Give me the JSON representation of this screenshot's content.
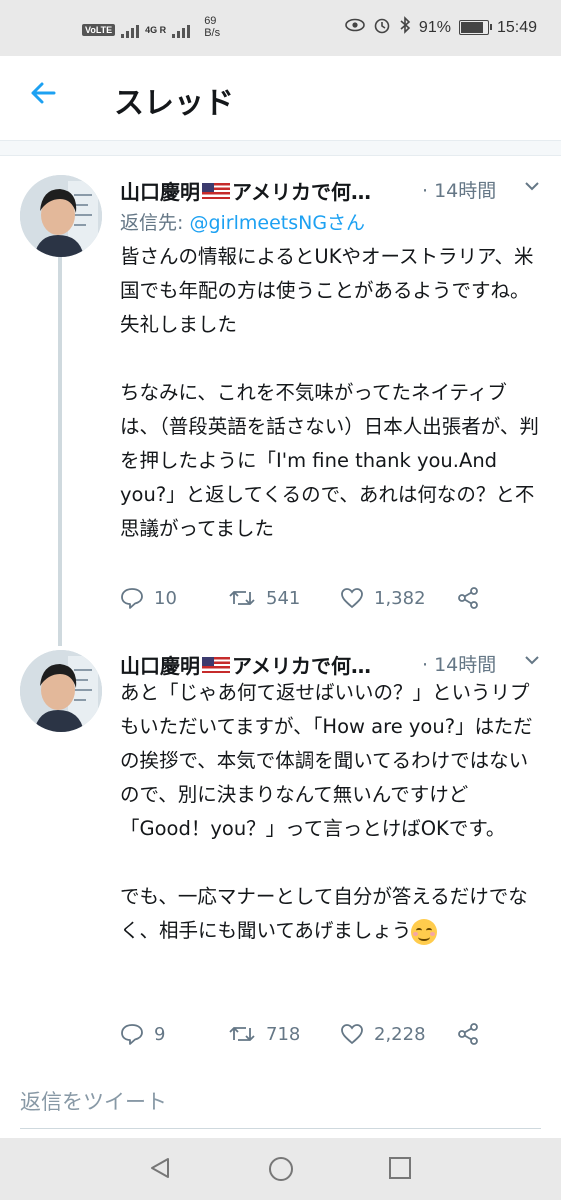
{
  "status_bar": {
    "volte": "VoLTE",
    "network": "4G R",
    "speed_value": "69",
    "speed_unit": "B/s",
    "battery": "91%",
    "time": "15:49"
  },
  "header": {
    "title": "スレッド"
  },
  "tweets": [
    {
      "name": "山口慶明",
      "name_suffix": "アメリカで何…",
      "time": "· 14時間",
      "reply_to_label": "返信先: ",
      "reply_to_user": "@girlmeetsNGさん",
      "text": "皆さんの情報によるとUKやオーストラリア、米国でも年配の方は使うことがあるようですね。失礼しました\n\nちなみに、これを不気味がってたネイティブは、（普段英語を話さない）日本人出張者が、判を押したように「I'm fine thank you.And you?」と返してくるので、あれは何なの？と不思議がってました",
      "replies": "10",
      "retweets": "541",
      "likes": "1,382"
    },
    {
      "name": "山口慶明",
      "name_suffix": "アメリカで何…",
      "time": "· 14時間",
      "text": "あと「じゃあ何て返せばいいの？」というリプもいただいてますが、「How are you?」はただの挨拶で、本気で体調を聞いてるわけではないので、別に決まりなんて無いんですけど「Good！you？」って言っとけばOKです。\n\nでも、一応マナーとして自分が答えるだけでなく、相手にも聞いてあげましょう",
      "emoji": "smiling-face-emoji",
      "replies": "9",
      "retweets": "718",
      "likes": "2,228"
    }
  ],
  "reply_bar": {
    "placeholder": "返信をツイート"
  },
  "colors": {
    "accent": "#1da1f2",
    "secondary_text": "#657786",
    "thread_line": "#cfd9de"
  },
  "icons": [
    "back-arrow-icon",
    "reply-icon",
    "retweet-icon",
    "like-icon",
    "share-icon",
    "chevron-down-icon",
    "nav-back-icon",
    "nav-home-icon",
    "nav-recents-icon"
  ]
}
